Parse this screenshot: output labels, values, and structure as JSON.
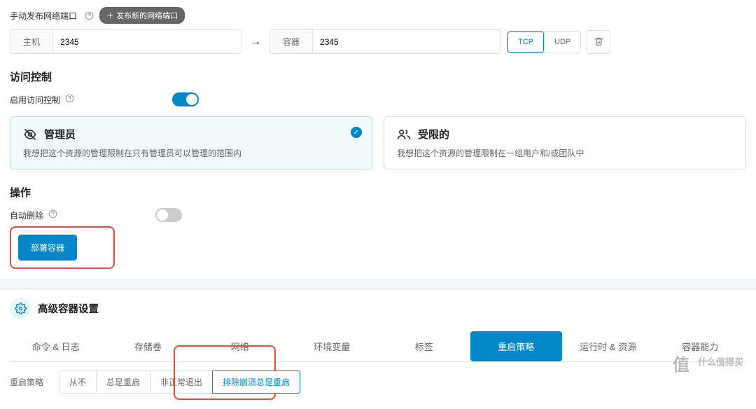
{
  "ports": {
    "heading": "手动发布网络端口",
    "add_button": "＋ 发布新的网络端口",
    "host_label": "主机",
    "host_value": "2345",
    "container_label": "容器",
    "container_value": "2345",
    "tcp_label": "TCP",
    "udp_label": "UDP"
  },
  "access": {
    "heading": "访问控制",
    "enable_label": "启用访问控制",
    "cards": {
      "admin": {
        "title": "管理员",
        "desc": "我想把这个资源的管理限制在只有管理员可以管理的范围内"
      },
      "restricted": {
        "title": "受限的",
        "desc": "我想把这个资源的管理限制在一组用户和/或团队中"
      }
    }
  },
  "ops": {
    "heading": "操作",
    "auto_remove": "自动删除",
    "deploy_button": "部署容器"
  },
  "advanced": {
    "heading": "高级容器设置",
    "tabs": {
      "cmd": "命令 & 日志",
      "volumes": "存储卷",
      "network": "网络",
      "env": "环境变量",
      "labels": "标签",
      "restart": "重启策略",
      "runtime": "运行时 & 资源",
      "caps": "容器能力"
    },
    "restart": {
      "label": "重启策略",
      "options": {
        "never": "从不",
        "always": "总是重启",
        "on_failure": "非正常退出",
        "unless_stopped": "排除崩溃总是重启"
      }
    }
  },
  "watermark": {
    "symbol": "值",
    "text": "什么值得买"
  }
}
